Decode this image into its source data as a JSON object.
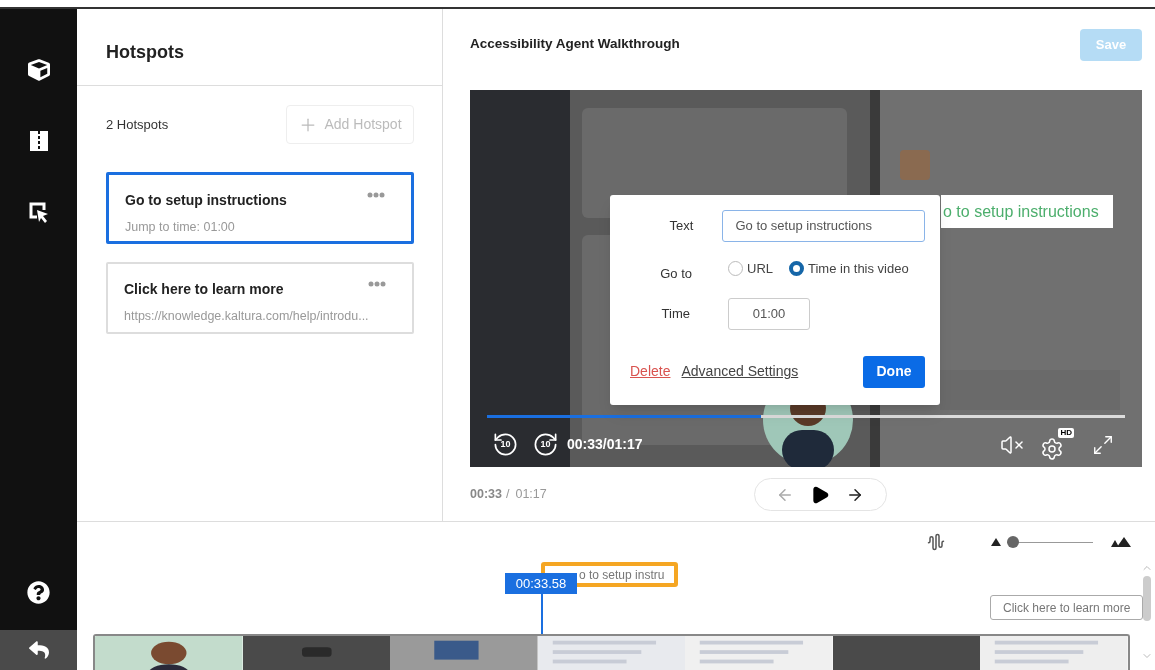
{
  "panel": {
    "title": "Hotspots",
    "count": "2 Hotspots",
    "add_button": {
      "label": "Add Hotspot",
      "disabled": true
    }
  },
  "hotspots": [
    {
      "title": "Go to setup instructions",
      "subtitle": "Jump to time: 01:00",
      "selected": true
    },
    {
      "title": "Click here to learn more",
      "subtitle": "https://knowledge.kaltura.com/help/introdu...",
      "selected": false
    }
  ],
  "editor": {
    "title": "Accessibility Agent Walkthrough",
    "save_button": {
      "label": "Save",
      "disabled": true
    }
  },
  "player": {
    "overlay_label": "o to setup instructions",
    "progress": {
      "level": 0.43
    },
    "time": "00:33/01:17",
    "skip_back": "10",
    "skip_forward": "10",
    "quality_badge": "HD"
  },
  "dialog": {
    "text_label": "Text",
    "text_value": "Go to setup instructions",
    "goto_label": "Go to",
    "options": [
      {
        "label": "URL",
        "selected": false
      },
      {
        "label": "Time in this video",
        "selected": true
      }
    ],
    "time_label": "Time",
    "time_value": "01:00",
    "delete": "Delete",
    "advanced": "Advanced Settings",
    "done": "Done"
  },
  "below_player": {
    "current": "00:33",
    "separator": "/",
    "duration": "01:17",
    "prev_disabled": true
  },
  "timeline": {
    "zoom": {
      "level": 0.0
    },
    "playhead": "00:33.58",
    "chips": [
      {
        "label": "o to setup instru",
        "selected": true
      },
      {
        "label": "Click here to learn more",
        "selected": false
      }
    ]
  }
}
